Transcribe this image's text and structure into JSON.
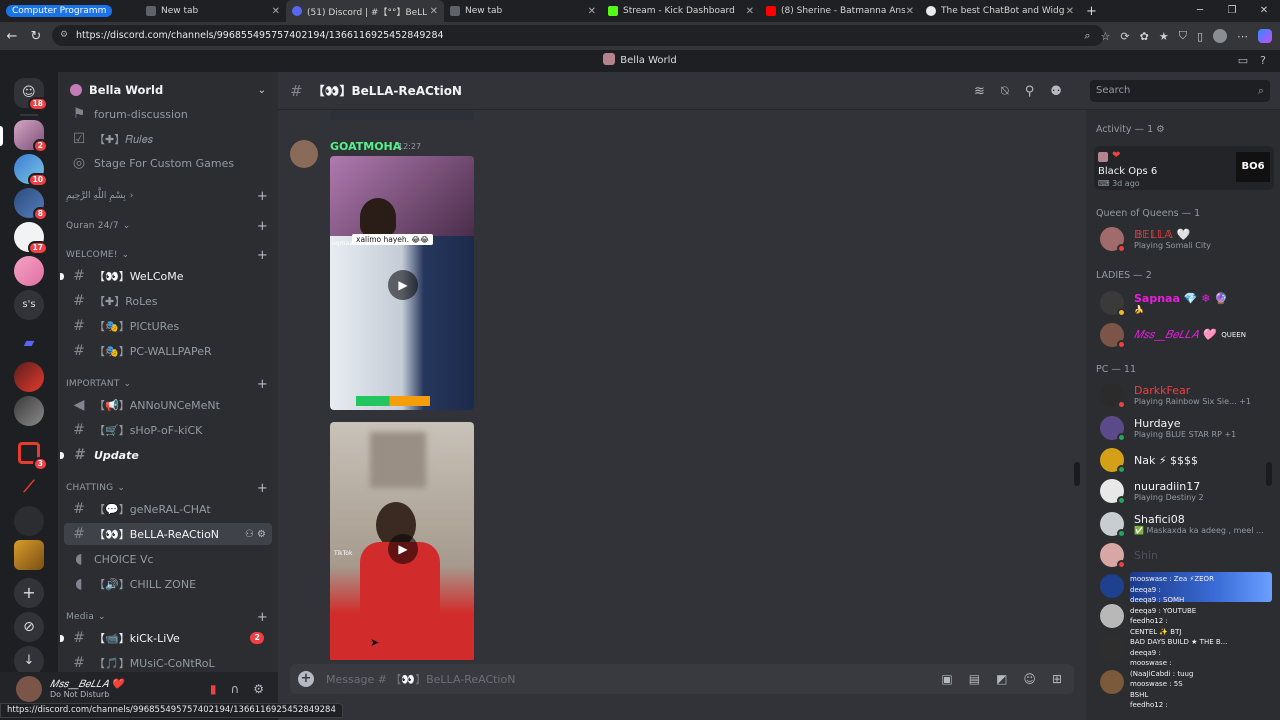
{
  "browser": {
    "tabs": [
      {
        "label": "Computer Programm",
        "group": true
      },
      {
        "label": "New tab"
      },
      {
        "label": "(51) Discord | #【°°】BeLLA-ReACti",
        "active": true
      },
      {
        "label": "New tab"
      },
      {
        "label": "Stream - Kick Dashboard"
      },
      {
        "label": "(8) Sherine - Batmanna Ansak | ك"
      },
      {
        "label": "The best ChatBot and Widgets fo"
      }
    ],
    "url": "https://discord.com/channels/996855495757402194/1366116925452849284",
    "status_url": "https://discord.com/channels/996855495757402194/1366116925452849284"
  },
  "discord": {
    "window_title": "Bella World",
    "guild_name": "Bella World",
    "rail_badges": [
      "18",
      "2",
      "10",
      "8",
      "17",
      "3"
    ],
    "rail_label": "s's",
    "channels": [
      {
        "label": "forum-discussion",
        "icon": "forum-icon"
      },
      {
        "label": "【✚】𝑅𝑢𝑙𝑒𝑠",
        "icon": "rules-icon"
      },
      {
        "label": "Stage For Custom Games",
        "icon": "stage-icon"
      }
    ],
    "categories": {
      "arabic": "بِسْمِ اللَّهِ الرَّحِيمِ",
      "quran": "Quran 24/7",
      "welcome": "WELCOME!",
      "important": "IMPORTANT",
      "chatting": "CHATTING",
      "media": "Media"
    },
    "welcome_channels": [
      "【👀】WeLCoMe",
      "【✚】RoLes",
      "【🎭】PICtURes",
      "【🎭】PC-WALLPAPeR"
    ],
    "important_channels": [
      "【📢】ANNoUNCeMeNt",
      "【🛒】sHoP-oF-kiCK",
      "Update"
    ],
    "chatting_channels": [
      "【💬】geNeRAL-CHAt",
      "【👀】BeLLA-ReACtioN",
      "CHOICE Vc",
      "【🔊】CHILL ZONE"
    ],
    "media_channels": [
      "【📹】kiCk-LiVe",
      "【🎵】MUsiC-CoNtRoL"
    ],
    "media_badge": "2",
    "current_channel": "【👀】BeLLA-ReACtioN",
    "search_placeholder": "Search",
    "message": {
      "author": "GOATMOHA",
      "time": "12:27",
      "caption": "xalimo hayeh. 😂😂",
      "handle": "uqmaa",
      "tiktok_label": "TikTok"
    },
    "composer_placeholder": "Message # 【👀】BeLLA-ReACtioN",
    "user": {
      "name": "𝑀𝑠𝑠__𝐵𝑒𝐿𝐿𝐴 ❤️",
      "status": "Do Not Disturb"
    },
    "members": {
      "activity_header": "Activity — 1",
      "activity_title": "Black Ops 6",
      "activity_time": "3d ago",
      "activity_logo": "BO6",
      "queen_header": "Queen of Queens — 1",
      "queen": {
        "name": "𝔹𝔼𝕃𝕃𝔸 🤍",
        "activity": "Playing Somali City"
      },
      "ladies_header": "LADIES — 2",
      "ladies": [
        {
          "name": "Sapnaa 💎 ❄ 🔮",
          "activity": "🍌"
        },
        {
          "name": "𝑀𝑠𝑠__𝐵𝑒𝐿𝐿𝐴 🩷",
          "tag": "QUEEN"
        }
      ],
      "pc_header": "PC — 11",
      "pc": [
        {
          "name": "DarkkFear",
          "activity": "Playing Rainbow Six Sie... +1",
          "color": "#f23f43"
        },
        {
          "name": "Hurdaye",
          "activity": "Playing BLUE STAR RP +1",
          "color": "#f2f3f5"
        },
        {
          "name": "Nak ⚡ $$$$",
          "activity": "",
          "color": "#f2f3f5"
        },
        {
          "name": "nuuradiin17",
          "activity": "Playing Destiny 2",
          "color": "#f2f3f5"
        },
        {
          "name": "Shafici08",
          "activity": "✅ Maskaxda ka adeeg , meel ...",
          "color": "#f2f3f5"
        },
        {
          "name": "Shin",
          "activity": "",
          "color": "#4e5058"
        }
      ],
      "chat_overlay": [
        "mooswase : Zea ⚡ZEOR",
        "deeqa9 :",
        "deeqa9 : SOMH",
        "deeqa9 : YOUTUBE",
        "feedho12 :",
        "CENTEL ✨ BTJ",
        "BAD DAYS BUILD ★ THE B...",
        "deeqa9 :",
        "mooswase :",
        "(NaaJiCabdi : tuug",
        "mooswase : 5S",
        "BSHL",
        "feedho12 :"
      ]
    }
  }
}
